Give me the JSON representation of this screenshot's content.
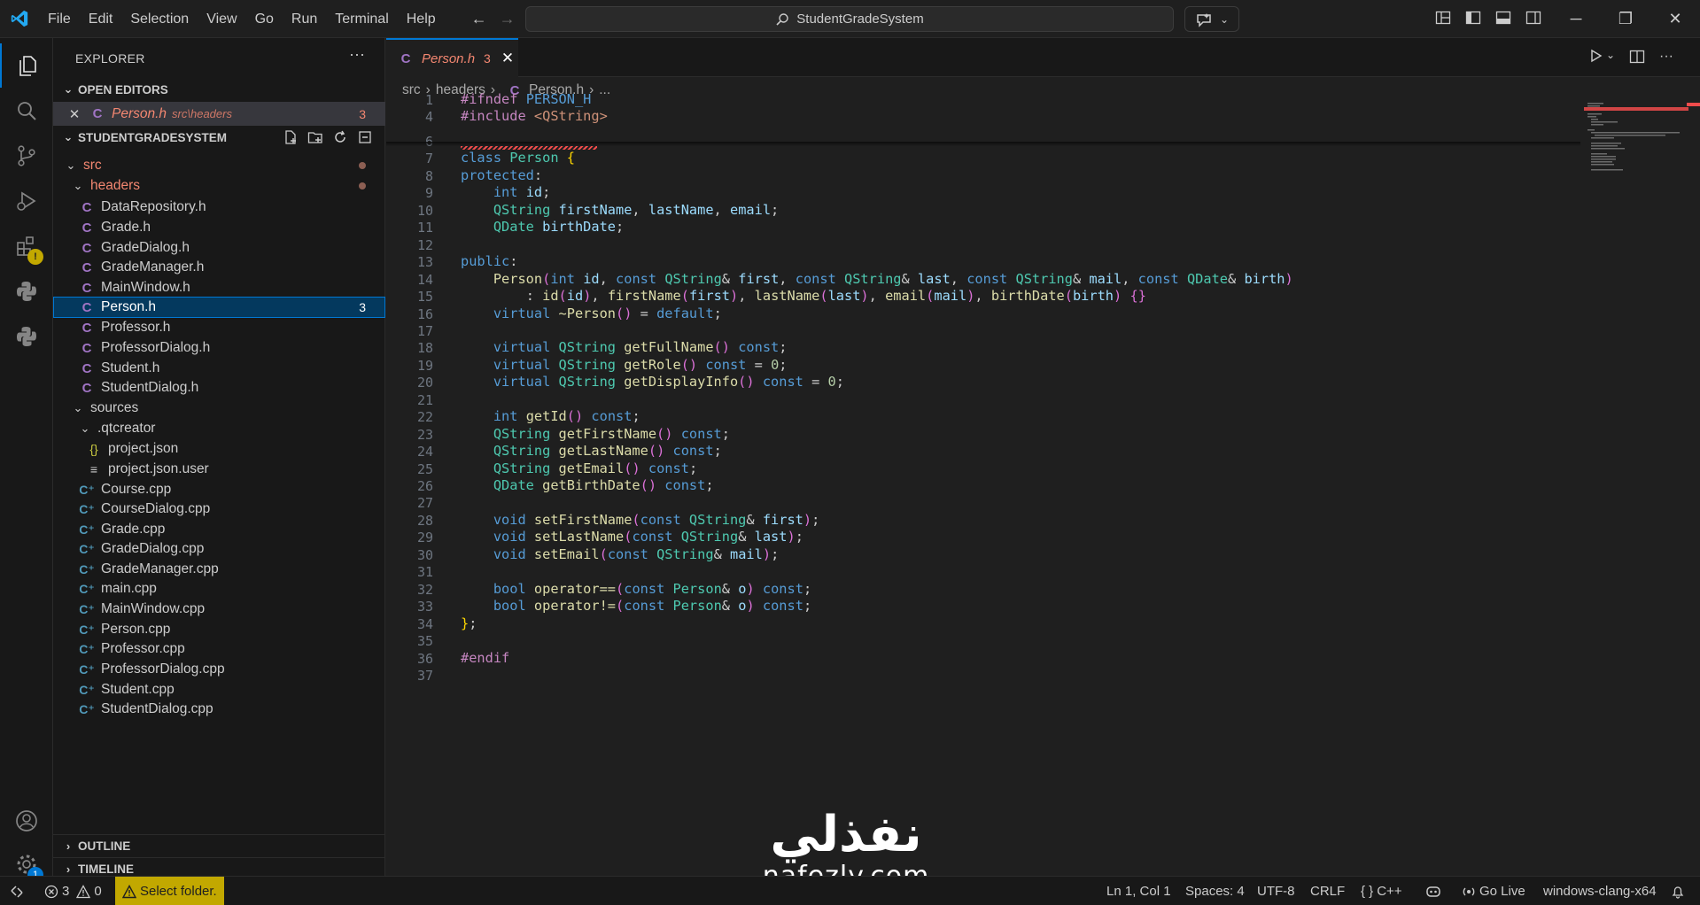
{
  "window": {
    "search_text": "StudentGradeSystem"
  },
  "menu": [
    "File",
    "Edit",
    "Selection",
    "View",
    "Go",
    "Run",
    "Terminal",
    "Help"
  ],
  "activity_bar": {
    "items": [
      "explorer-icon",
      "search-icon",
      "source-control-icon",
      "run-debug-icon",
      "extensions-icon",
      "python-icon",
      "python-icon-2"
    ],
    "extensions_badge": "!",
    "settings_badge": "1"
  },
  "sidebar": {
    "title": "EXPLORER",
    "more": "···",
    "open_editors": {
      "header": "OPEN EDITORS",
      "items": [
        {
          "name": "Person.h",
          "path": "src\\headers",
          "problems": "3"
        }
      ]
    },
    "workspace": {
      "header": "STUDENTGRADESYSTEM",
      "tree": [
        {
          "label": "src",
          "type": "folder-open"
        },
        {
          "label": "headers",
          "type": "folder-open"
        },
        {
          "label": "DataRepository.h",
          "type": "h"
        },
        {
          "label": "Grade.h",
          "type": "h"
        },
        {
          "label": "GradeDialog.h",
          "type": "h"
        },
        {
          "label": "GradeManager.h",
          "type": "h"
        },
        {
          "label": "MainWindow.h",
          "type": "h"
        },
        {
          "label": "Person.h",
          "type": "h",
          "problems": "3"
        },
        {
          "label": "Professor.h",
          "type": "h"
        },
        {
          "label": "ProfessorDialog.h",
          "type": "h"
        },
        {
          "label": "Student.h",
          "type": "h"
        },
        {
          "label": "StudentDialog.h",
          "type": "h"
        },
        {
          "label": "sources",
          "type": "folder-open"
        },
        {
          "label": ".qtcreator",
          "type": "folder-open"
        },
        {
          "label": "project.json",
          "type": "json"
        },
        {
          "label": "project.json.user",
          "type": "txt"
        },
        {
          "label": "Course.cpp",
          "type": "cpp"
        },
        {
          "label": "CourseDialog.cpp",
          "type": "cpp"
        },
        {
          "label": "Grade.cpp",
          "type": "cpp"
        },
        {
          "label": "GradeDialog.cpp",
          "type": "cpp"
        },
        {
          "label": "GradeManager.cpp",
          "type": "cpp"
        },
        {
          "label": "main.cpp",
          "type": "cpp"
        },
        {
          "label": "MainWindow.cpp",
          "type": "cpp"
        },
        {
          "label": "Person.cpp",
          "type": "cpp"
        },
        {
          "label": "Professor.cpp",
          "type": "cpp"
        },
        {
          "label": "ProfessorDialog.cpp",
          "type": "cpp"
        },
        {
          "label": "Student.cpp",
          "type": "cpp"
        },
        {
          "label": "StudentDialog.cpp",
          "type": "cpp"
        }
      ]
    },
    "outline_header": "OUTLINE",
    "timeline_header": "TIMELINE"
  },
  "editor": {
    "tab": {
      "name": "Person.h",
      "problems": "3",
      "icon": "C"
    },
    "breadcrumb": [
      "src",
      "headers",
      "Person.h",
      "..."
    ],
    "code_lines": [
      {
        "n": "1",
        "text": "#ifndef PERSON_H"
      },
      {
        "n": "4",
        "text": "#include <QString>"
      },
      {
        "n": "6",
        "text": ""
      },
      {
        "n": "7",
        "text": "class Person {"
      },
      {
        "n": "8",
        "text": "protected:"
      },
      {
        "n": "9",
        "text": "    int id;"
      },
      {
        "n": "10",
        "text": "    QString firstName, lastName, email;"
      },
      {
        "n": "11",
        "text": "    QDate birthDate;"
      },
      {
        "n": "12",
        "text": ""
      },
      {
        "n": "13",
        "text": "public:"
      },
      {
        "n": "14",
        "text": "    Person(int id, const QString& first, const QString& last, const QString& mail, const QDate& birth)"
      },
      {
        "n": "15",
        "text": "        : id(id), firstName(first), lastName(last), email(mail), birthDate(birth) {}"
      },
      {
        "n": "16",
        "text": "    virtual ~Person() = default;"
      },
      {
        "n": "17",
        "text": ""
      },
      {
        "n": "18",
        "text": "    virtual QString getFullName() const;"
      },
      {
        "n": "19",
        "text": "    virtual QString getRole() const = 0;"
      },
      {
        "n": "20",
        "text": "    virtual QString getDisplayInfo() const = 0;"
      },
      {
        "n": "21",
        "text": ""
      },
      {
        "n": "22",
        "text": "    int getId() const;"
      },
      {
        "n": "23",
        "text": "    QString getFirstName() const;"
      },
      {
        "n": "24",
        "text": "    QString getLastName() const;"
      },
      {
        "n": "25",
        "text": "    QString getEmail() const;"
      },
      {
        "n": "26",
        "text": "    QDate getBirthDate() const;"
      },
      {
        "n": "27",
        "text": ""
      },
      {
        "n": "28",
        "text": "    void setFirstName(const QString& first);"
      },
      {
        "n": "29",
        "text": "    void setLastName(const QString& last);"
      },
      {
        "n": "30",
        "text": "    void setEmail(const QString& mail);"
      },
      {
        "n": "31",
        "text": ""
      },
      {
        "n": "32",
        "text": "    bool operator==(const Person& o) const;"
      },
      {
        "n": "33",
        "text": "    bool operator!=(const Person& o) const;"
      },
      {
        "n": "34",
        "text": "};"
      },
      {
        "n": "35",
        "text": ""
      },
      {
        "n": "36",
        "text": "#endif"
      },
      {
        "n": "37",
        "text": ""
      }
    ]
  },
  "watermark": {
    "arabic": "نفذلي",
    "latin": "nafezly.com"
  },
  "statusbar": {
    "errors": "3",
    "warnings": "0",
    "select_folder": "Select folder.",
    "position": "Ln 1, Col 1",
    "spaces": "Spaces: 4",
    "encoding": "UTF-8",
    "eol": "CRLF",
    "language": "C++",
    "go_live": "Go Live",
    "config": "windows-clang-x64"
  },
  "colors": {
    "accent": "#0078d4",
    "error": "#f14c4c",
    "warning_bg": "#c2a800"
  }
}
